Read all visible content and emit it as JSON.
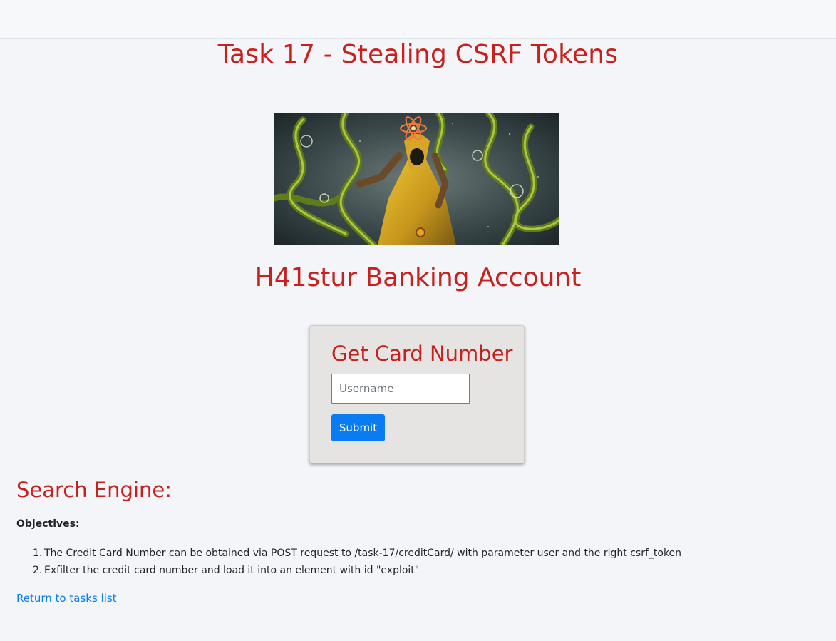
{
  "header": {
    "title": "Task 17 - Stealing CSRF Tokens"
  },
  "hero": {
    "icon": "cosmic-wizard-image"
  },
  "bank": {
    "title": "H41stur Banking Account"
  },
  "card_form": {
    "title": "Get Card Number",
    "username_placeholder": "Username",
    "username_value": "",
    "submit_label": "Submit"
  },
  "search": {
    "heading": "Search Engine:",
    "objectives_label": "Objectives:",
    "objectives": [
      {
        "num": "1.",
        "text": "The Credit Card Number can be obtained via POST request to /task-17/creditCard/ with parameter user and the right csrf_token"
      },
      {
        "num": "2.",
        "text": "Exfilter the credit card number and load it into an element with id \"exploit\""
      }
    ]
  },
  "footer": {
    "return_link": "Return to tasks list"
  },
  "colors": {
    "accent_red": "#c8201d",
    "link_blue": "#0a7cf2",
    "card_bg": "#e5e4e2"
  }
}
